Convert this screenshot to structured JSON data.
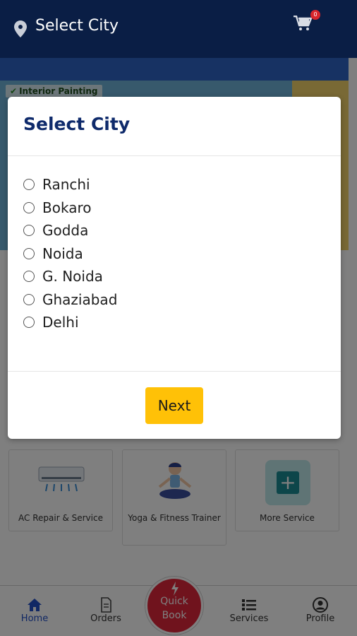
{
  "header": {
    "title": "Select City",
    "cart_count": "0",
    "icons": [
      "location-pin-icon",
      "cart-icon"
    ]
  },
  "background": {
    "banner_tag": "Interior Painting",
    "services": [
      {
        "label": "AC Repair & Service",
        "icon": "ac-unit-icon"
      },
      {
        "label": "Yoga & Fitness Trainer",
        "icon": "yoga-icon"
      },
      {
        "label": "More Service",
        "icon": "plus-icon"
      }
    ]
  },
  "bottom_nav": {
    "items": [
      {
        "label": "Home",
        "icon": "home-icon",
        "active": true
      },
      {
        "label": "Orders",
        "icon": "document-icon"
      },
      {
        "label": "Services",
        "icon": "list-icon"
      },
      {
        "label": "Profile",
        "icon": "user-circle-icon"
      }
    ],
    "quick_book": "Quick\nBook",
    "active_color": "#2250c8",
    "quick_book_color": "#e0263a"
  },
  "modal": {
    "title": "Select City",
    "cities": [
      "Ranchi",
      "Bokaro",
      "Godda",
      "Noida",
      "G. Noida",
      "Ghaziabad",
      "Delhi"
    ],
    "next_label": "Next",
    "accent_color": "#ffc107",
    "title_color": "#0e2a6b"
  }
}
